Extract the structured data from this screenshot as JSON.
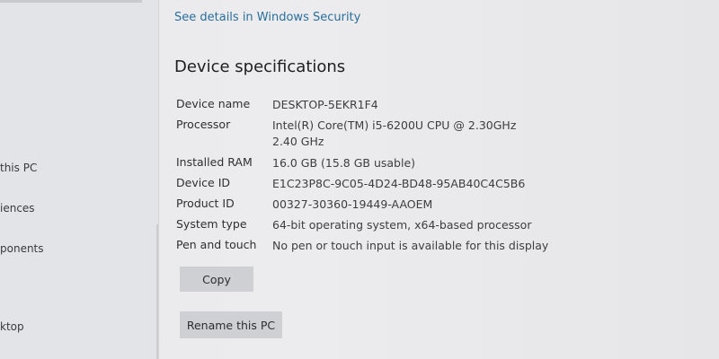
{
  "sidebar": {
    "items": [
      {
        "label": "this PC"
      },
      {
        "label": "iences"
      },
      {
        "label": "ponents"
      },
      {
        "label": "ktop"
      }
    ]
  },
  "main": {
    "security_link": "See details in Windows Security",
    "section_title": "Device specifications",
    "specs": [
      {
        "label": "Device name",
        "value": "DESKTOP-5EKR1F4"
      },
      {
        "label": "Processor",
        "value": "Intel(R) Core(TM) i5-6200U CPU @ 2.30GHz   2.40 GHz"
      },
      {
        "label": "Installed RAM",
        "value": "16.0 GB (15.8 GB usable)"
      },
      {
        "label": "Device ID",
        "value": "E1C23P8C-9C05-4D24-BD48-95AB40C4C5B6"
      },
      {
        "label": "Product ID",
        "value": "00327-30360-19449-AAOEM"
      },
      {
        "label": "System type",
        "value": "64-bit operating system, x64-based processor"
      },
      {
        "label": "Pen and touch",
        "value": "No pen or touch input is available for this display"
      }
    ],
    "copy_label": "Copy",
    "rename_label": "Rename this PC"
  }
}
